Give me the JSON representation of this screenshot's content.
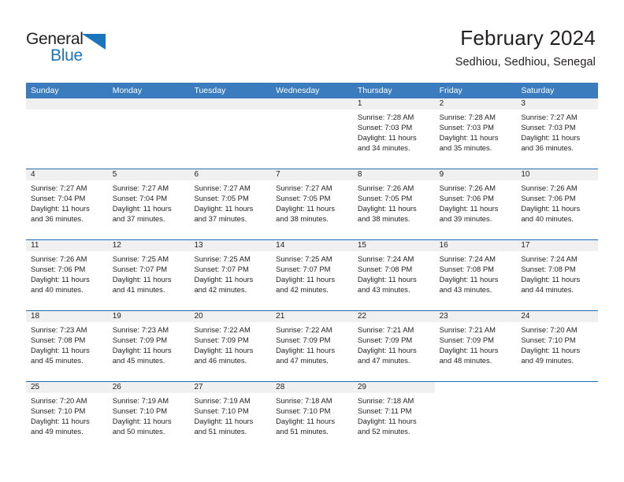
{
  "brand": {
    "name_part1": "General",
    "name_part2": "Blue",
    "accent_color": "#1b75bb"
  },
  "header": {
    "title": "February 2024",
    "subtitle": "Sedhiou, Sedhiou, Senegal"
  },
  "calendar": {
    "header_bg": "#3a7cbe",
    "row_divider_color": "#1f6cb0",
    "daynum_bg": "#f0f0f0",
    "weekdays": [
      "Sunday",
      "Monday",
      "Tuesday",
      "Wednesday",
      "Thursday",
      "Friday",
      "Saturday"
    ],
    "weeks": [
      [
        {
          "day": "",
          "lines": []
        },
        {
          "day": "",
          "lines": []
        },
        {
          "day": "",
          "lines": []
        },
        {
          "day": "",
          "lines": []
        },
        {
          "day": "1",
          "lines": [
            "Sunrise: 7:28 AM",
            "Sunset: 7:03 PM",
            "Daylight: 11 hours",
            "and 34 minutes."
          ]
        },
        {
          "day": "2",
          "lines": [
            "Sunrise: 7:28 AM",
            "Sunset: 7:03 PM",
            "Daylight: 11 hours",
            "and 35 minutes."
          ]
        },
        {
          "day": "3",
          "lines": [
            "Sunrise: 7:27 AM",
            "Sunset: 7:03 PM",
            "Daylight: 11 hours",
            "and 36 minutes."
          ]
        }
      ],
      [
        {
          "day": "4",
          "lines": [
            "Sunrise: 7:27 AM",
            "Sunset: 7:04 PM",
            "Daylight: 11 hours",
            "and 36 minutes."
          ]
        },
        {
          "day": "5",
          "lines": [
            "Sunrise: 7:27 AM",
            "Sunset: 7:04 PM",
            "Daylight: 11 hours",
            "and 37 minutes."
          ]
        },
        {
          "day": "6",
          "lines": [
            "Sunrise: 7:27 AM",
            "Sunset: 7:05 PM",
            "Daylight: 11 hours",
            "and 37 minutes."
          ]
        },
        {
          "day": "7",
          "lines": [
            "Sunrise: 7:27 AM",
            "Sunset: 7:05 PM",
            "Daylight: 11 hours",
            "and 38 minutes."
          ]
        },
        {
          "day": "8",
          "lines": [
            "Sunrise: 7:26 AM",
            "Sunset: 7:05 PM",
            "Daylight: 11 hours",
            "and 38 minutes."
          ]
        },
        {
          "day": "9",
          "lines": [
            "Sunrise: 7:26 AM",
            "Sunset: 7:06 PM",
            "Daylight: 11 hours",
            "and 39 minutes."
          ]
        },
        {
          "day": "10",
          "lines": [
            "Sunrise: 7:26 AM",
            "Sunset: 7:06 PM",
            "Daylight: 11 hours",
            "and 40 minutes."
          ]
        }
      ],
      [
        {
          "day": "11",
          "lines": [
            "Sunrise: 7:26 AM",
            "Sunset: 7:06 PM",
            "Daylight: 11 hours",
            "and 40 minutes."
          ]
        },
        {
          "day": "12",
          "lines": [
            "Sunrise: 7:25 AM",
            "Sunset: 7:07 PM",
            "Daylight: 11 hours",
            "and 41 minutes."
          ]
        },
        {
          "day": "13",
          "lines": [
            "Sunrise: 7:25 AM",
            "Sunset: 7:07 PM",
            "Daylight: 11 hours",
            "and 42 minutes."
          ]
        },
        {
          "day": "14",
          "lines": [
            "Sunrise: 7:25 AM",
            "Sunset: 7:07 PM",
            "Daylight: 11 hours",
            "and 42 minutes."
          ]
        },
        {
          "day": "15",
          "lines": [
            "Sunrise: 7:24 AM",
            "Sunset: 7:08 PM",
            "Daylight: 11 hours",
            "and 43 minutes."
          ]
        },
        {
          "day": "16",
          "lines": [
            "Sunrise: 7:24 AM",
            "Sunset: 7:08 PM",
            "Daylight: 11 hours",
            "and 43 minutes."
          ]
        },
        {
          "day": "17",
          "lines": [
            "Sunrise: 7:24 AM",
            "Sunset: 7:08 PM",
            "Daylight: 11 hours",
            "and 44 minutes."
          ]
        }
      ],
      [
        {
          "day": "18",
          "lines": [
            "Sunrise: 7:23 AM",
            "Sunset: 7:08 PM",
            "Daylight: 11 hours",
            "and 45 minutes."
          ]
        },
        {
          "day": "19",
          "lines": [
            "Sunrise: 7:23 AM",
            "Sunset: 7:09 PM",
            "Daylight: 11 hours",
            "and 45 minutes."
          ]
        },
        {
          "day": "20",
          "lines": [
            "Sunrise: 7:22 AM",
            "Sunset: 7:09 PM",
            "Daylight: 11 hours",
            "and 46 minutes."
          ]
        },
        {
          "day": "21",
          "lines": [
            "Sunrise: 7:22 AM",
            "Sunset: 7:09 PM",
            "Daylight: 11 hours",
            "and 47 minutes."
          ]
        },
        {
          "day": "22",
          "lines": [
            "Sunrise: 7:21 AM",
            "Sunset: 7:09 PM",
            "Daylight: 11 hours",
            "and 47 minutes."
          ]
        },
        {
          "day": "23",
          "lines": [
            "Sunrise: 7:21 AM",
            "Sunset: 7:09 PM",
            "Daylight: 11 hours",
            "and 48 minutes."
          ]
        },
        {
          "day": "24",
          "lines": [
            "Sunrise: 7:20 AM",
            "Sunset: 7:10 PM",
            "Daylight: 11 hours",
            "and 49 minutes."
          ]
        }
      ],
      [
        {
          "day": "25",
          "lines": [
            "Sunrise: 7:20 AM",
            "Sunset: 7:10 PM",
            "Daylight: 11 hours",
            "and 49 minutes."
          ]
        },
        {
          "day": "26",
          "lines": [
            "Sunrise: 7:19 AM",
            "Sunset: 7:10 PM",
            "Daylight: 11 hours",
            "and 50 minutes."
          ]
        },
        {
          "day": "27",
          "lines": [
            "Sunrise: 7:19 AM",
            "Sunset: 7:10 PM",
            "Daylight: 11 hours",
            "and 51 minutes."
          ]
        },
        {
          "day": "28",
          "lines": [
            "Sunrise: 7:18 AM",
            "Sunset: 7:10 PM",
            "Daylight: 11 hours",
            "and 51 minutes."
          ]
        },
        {
          "day": "29",
          "lines": [
            "Sunrise: 7:18 AM",
            "Sunset: 7:11 PM",
            "Daylight: 11 hours",
            "and 52 minutes."
          ]
        },
        {
          "day": "",
          "lines": []
        },
        {
          "day": "",
          "lines": []
        }
      ]
    ]
  }
}
